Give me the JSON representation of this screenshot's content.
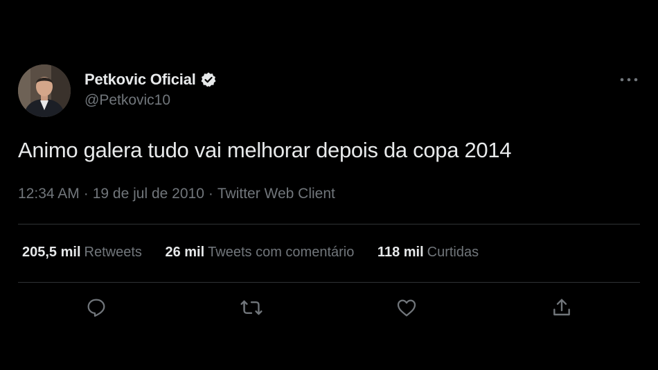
{
  "author": {
    "display_name": "Petkovic Oficial",
    "handle": "@Petkovic10",
    "verified_icon": "verified-badge-icon",
    "avatar_icon": "profile-photo"
  },
  "tweet": {
    "text": "Animo galera tudo vai melhorar depois da copa 2014",
    "time": "12:34 AM",
    "separator": "·",
    "date": "19 de jul de 2010",
    "source": "Twitter Web Client"
  },
  "stats": {
    "retweets_count": "205,5 mil",
    "retweets_label": "Retweets",
    "quotes_count": "26 mil",
    "quotes_label": "Tweets com comentário",
    "likes_count": "118 mil",
    "likes_label": "Curtidas"
  },
  "actions": {
    "reply_icon": "reply-icon",
    "retweet_icon": "retweet-icon",
    "like_icon": "like-icon",
    "share_icon": "share-icon"
  },
  "colors": {
    "background": "#000000",
    "primary_text": "#e7e9ea",
    "secondary_text": "#71767b",
    "divider": "#2f3336"
  }
}
